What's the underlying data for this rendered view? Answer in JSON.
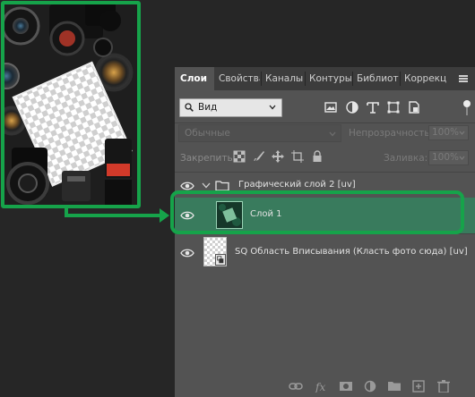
{
  "panel": {
    "tabs": [
      {
        "label": "Слои",
        "active": true
      },
      {
        "label": "Свойства",
        "active": false
      },
      {
        "label": "Каналы",
        "active": false
      },
      {
        "label": "Контуры",
        "active": false
      },
      {
        "label": "Библиот",
        "active": false
      },
      {
        "label": "Коррекц",
        "active": false
      }
    ],
    "filter": {
      "kind_label": "Вид",
      "icons": [
        "image-filter-icon",
        "adjustment-filter-icon",
        "type-filter-icon",
        "shape-filter-icon",
        "smart-object-filter-icon"
      ]
    },
    "blend": {
      "mode": "Обычные",
      "opacity_label": "Непрозрачность:",
      "opacity_value": "100%"
    },
    "lock": {
      "label": "Закрепить:",
      "icons": [
        "lock-transparent-icon",
        "lock-image-icon",
        "lock-position-icon",
        "lock-artboard-icon",
        "lock-all-icon"
      ],
      "fill_label": "Заливка:",
      "fill_value": "100%"
    },
    "layers": [
      {
        "name": "Графический слой 2 [uv]",
        "type": "group",
        "visible": true
      },
      {
        "name": "Слой 1",
        "type": "pixel",
        "visible": true,
        "selected": true
      },
      {
        "name": "SQ Область Вписывания (Класть фото сюда) [uv]",
        "type": "smart-object",
        "visible": true
      }
    ],
    "bottom_icons": [
      "link-icon",
      "fx-icon",
      "mask-icon",
      "adjustment-layer-icon",
      "new-group-icon",
      "new-layer-icon",
      "delete-icon"
    ]
  },
  "colors": {
    "accent": "#16a34a",
    "selection": "#397b5d",
    "panel_bg": "#535353",
    "app_bg": "#262626"
  }
}
